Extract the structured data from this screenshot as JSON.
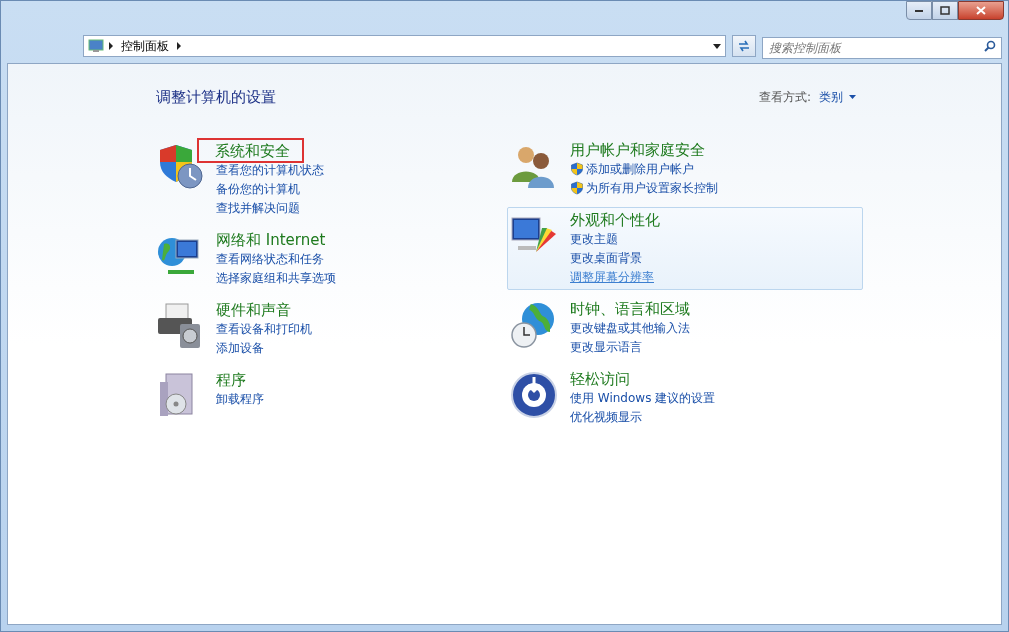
{
  "address_bar": {
    "breadcrumb": [
      "控制面板"
    ]
  },
  "search": {
    "placeholder": "搜索控制面板"
  },
  "heading": "调整计算机的设置",
  "view_by": {
    "label": "查看方式:",
    "value": "类别"
  },
  "columns": [
    [
      {
        "title": "系统和安全",
        "annotated": true,
        "hovered": false,
        "links": [
          {
            "text": "查看您的计算机状态",
            "shield": false,
            "hovered": false
          },
          {
            "text": "备份您的计算机",
            "shield": false,
            "hovered": false
          },
          {
            "text": "查找并解决问题",
            "shield": false,
            "hovered": false
          }
        ]
      },
      {
        "title": "网络和 Internet",
        "annotated": false,
        "hovered": false,
        "links": [
          {
            "text": "查看网络状态和任务",
            "shield": false,
            "hovered": false
          },
          {
            "text": "选择家庭组和共享选项",
            "shield": false,
            "hovered": false
          }
        ]
      },
      {
        "title": "硬件和声音",
        "annotated": false,
        "hovered": false,
        "links": [
          {
            "text": "查看设备和打印机",
            "shield": false,
            "hovered": false
          },
          {
            "text": "添加设备",
            "shield": false,
            "hovered": false
          }
        ]
      },
      {
        "title": "程序",
        "annotated": false,
        "hovered": false,
        "links": [
          {
            "text": "卸载程序",
            "shield": false,
            "hovered": false
          }
        ]
      }
    ],
    [
      {
        "title": "用户帐户和家庭安全",
        "annotated": false,
        "hovered": false,
        "links": [
          {
            "text": "添加或删除用户帐户",
            "shield": true,
            "hovered": false
          },
          {
            "text": "为所有用户设置家长控制",
            "shield": true,
            "hovered": false
          }
        ]
      },
      {
        "title": "外观和个性化",
        "annotated": false,
        "hovered": true,
        "links": [
          {
            "text": "更改主题",
            "shield": false,
            "hovered": false
          },
          {
            "text": "更改桌面背景",
            "shield": false,
            "hovered": false
          },
          {
            "text": "调整屏幕分辨率",
            "shield": false,
            "hovered": true
          }
        ]
      },
      {
        "title": "时钟、语言和区域",
        "annotated": false,
        "hovered": false,
        "links": [
          {
            "text": "更改键盘或其他输入法",
            "shield": false,
            "hovered": false
          },
          {
            "text": "更改显示语言",
            "shield": false,
            "hovered": false
          }
        ]
      },
      {
        "title": "轻松访问",
        "annotated": false,
        "hovered": false,
        "links": [
          {
            "text": "使用 Windows 建议的设置",
            "shield": false,
            "hovered": false
          },
          {
            "text": "优化视频显示",
            "shield": false,
            "hovered": false
          }
        ]
      }
    ]
  ]
}
